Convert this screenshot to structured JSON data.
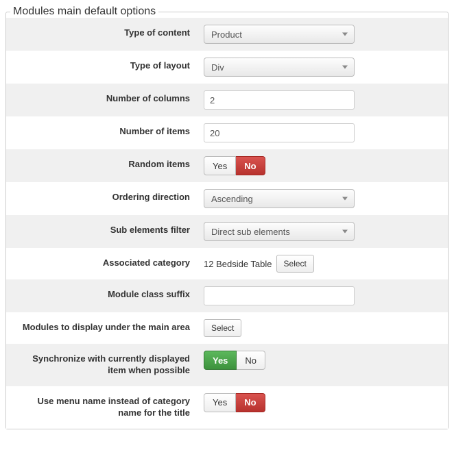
{
  "legend": "Modules main default options",
  "fields": {
    "type_of_content": {
      "label": "Type of content",
      "value": "Product"
    },
    "type_of_layout": {
      "label": "Type of layout",
      "value": "Div"
    },
    "number_of_columns": {
      "label": "Number of columns",
      "value": "2"
    },
    "number_of_items": {
      "label": "Number of items",
      "value": "20"
    },
    "random_items": {
      "label": "Random items",
      "yes": "Yes",
      "no": "No",
      "value": "No"
    },
    "ordering_direction": {
      "label": "Ordering direction",
      "value": "Ascending"
    },
    "sub_elements_filter": {
      "label": "Sub elements filter",
      "value": "Direct sub elements"
    },
    "associated_category": {
      "label": "Associated category",
      "value": "12 Bedside Table",
      "select_btn": "Select"
    },
    "module_class_suffix": {
      "label": "Module class suffix",
      "value": ""
    },
    "modules_under_main": {
      "label": "Modules to display under the main area",
      "select_btn": "Select"
    },
    "synchronize": {
      "label": "Synchronize with currently displayed item when possible",
      "yes": "Yes",
      "no": "No",
      "value": "Yes"
    },
    "use_menu_name": {
      "label": "Use menu name instead of category name for the title",
      "yes": "Yes",
      "no": "No",
      "value": "No"
    }
  }
}
